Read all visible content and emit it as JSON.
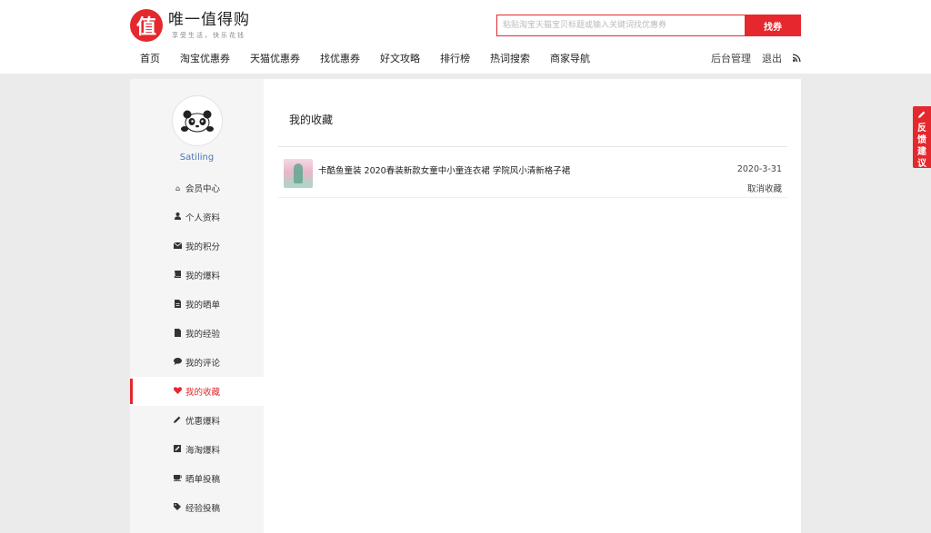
{
  "brand": {
    "badge": "值",
    "title": "唯一值得购",
    "slogan": "享受生活，快乐花钱",
    "accent": "#e4282d"
  },
  "search": {
    "placeholder": "粘贴淘宝天猫宝贝标题或输入关键词找优惠券",
    "button": "找券"
  },
  "nav": {
    "items": [
      "首页",
      "淘宝优惠券",
      "天猫优惠券",
      "找优惠券",
      "好文攻略",
      "排行榜",
      "热词搜索",
      "商家导航"
    ],
    "admin": "后台管理",
    "logout": "退出",
    "rss_icon": "rss-icon"
  },
  "user": {
    "name": "Satiling",
    "avatar_icon": "panda-avatar"
  },
  "sidebar": {
    "items": [
      {
        "label": "会员中心",
        "icon": "home-icon"
      },
      {
        "label": "个人资料",
        "icon": "user-icon"
      },
      {
        "label": "我的积分",
        "icon": "envelope-icon"
      },
      {
        "label": "我的爆料",
        "icon": "book-icon"
      },
      {
        "label": "我的晒单",
        "icon": "file-icon"
      },
      {
        "label": "我的经验",
        "icon": "document-icon"
      },
      {
        "label": "我的评论",
        "icon": "comment-icon"
      },
      {
        "label": "我的收藏",
        "icon": "heart-icon",
        "active": true
      },
      {
        "label": "优惠爆料",
        "icon": "pencil-icon"
      },
      {
        "label": "海淘爆料",
        "icon": "edit-icon"
      },
      {
        "label": "晒单投稿",
        "icon": "cup-icon"
      },
      {
        "label": "经验投稿",
        "icon": "tag-icon"
      }
    ]
  },
  "main": {
    "title": "我的收藏",
    "favorites": [
      {
        "title": "卡酷鱼童装 2020春装新款女童中小童连衣裙 学院风小清新格子裙",
        "date": "2020-3-31",
        "action": "取消收藏"
      }
    ]
  },
  "feedback": {
    "text": [
      "反",
      "馈",
      "建",
      "议"
    ]
  }
}
